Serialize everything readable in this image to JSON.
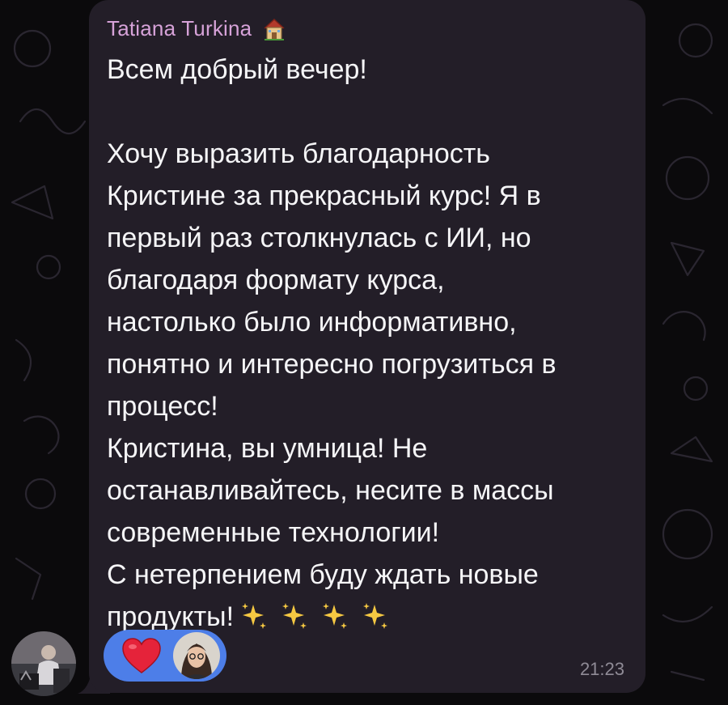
{
  "message": {
    "sender_name": "Tatiana Turkina",
    "sender_emoji_icon": "house-icon",
    "lines": [
      "Всем добрый вечер!",
      "",
      "Хочу выразить благодарность",
      "Кристине за прекрасный курс! Я в",
      "первый раз столкнулась с ИИ, но",
      "благодаря формату курса,",
      "настолько было информативно,",
      "понятно и интересно погрузиться в",
      "процесс!",
      "Кристина, вы умница! Не",
      "останавливайтесь, несите в массы",
      "современные технологии!",
      "С нетерпением буду ждать новые",
      "продукты!"
    ],
    "trailing_emoji_icons": [
      "sparkles-icon",
      "sparkles-icon",
      "sparkles-icon",
      "sparkles-icon"
    ],
    "time": "21:23"
  },
  "reaction": {
    "emoji_icon": "heart-icon",
    "reactor_avatar_icon": "avatar"
  },
  "colors": {
    "background": "#0b0a0c",
    "bubble": "#231e28",
    "sender_name": "#d6a2d8",
    "text": "#f5f5f7",
    "reaction_pill": "#4d7ee8",
    "timestamp": "#8f8b96",
    "heart": "#e5233a",
    "sparkle": "#f5c842"
  }
}
